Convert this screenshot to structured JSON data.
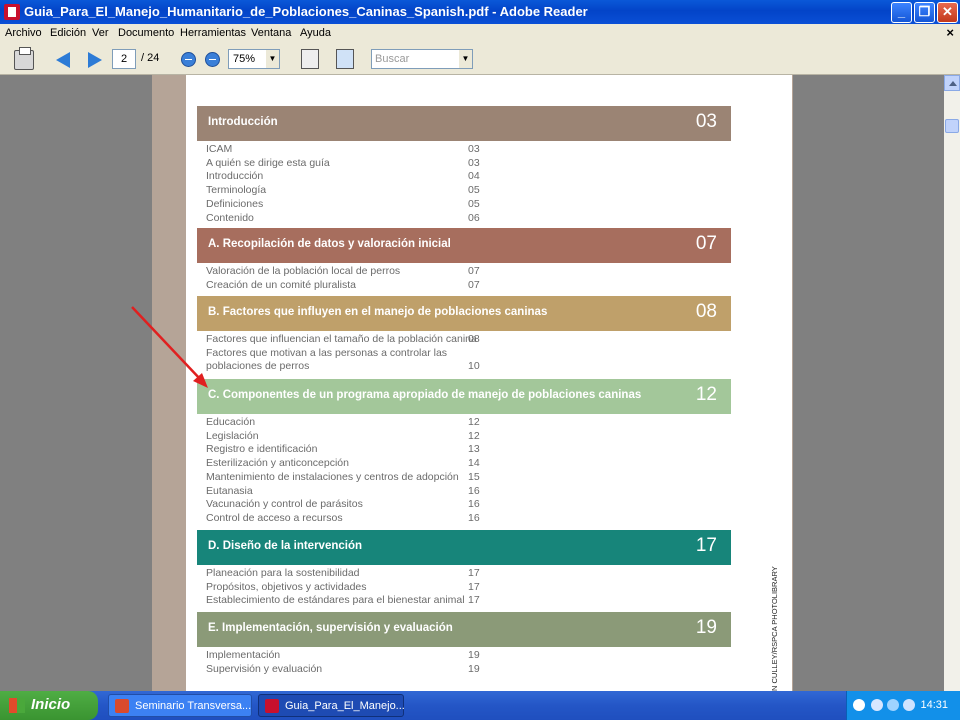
{
  "window": {
    "title": "Guia_Para_El_Manejo_Humanitario_de_Poblaciones_Caninas_Spanish.pdf - Adobe Reader",
    "minimize": "_",
    "maximize": "❐",
    "close": "✕"
  },
  "menu": {
    "items": [
      "Archivo",
      "Edición",
      "Ver",
      "Documento",
      "Herramientas",
      "Ventana",
      "Ayuda"
    ],
    "close": "×"
  },
  "toolbar": {
    "page_current": "2",
    "page_total": "/ 24",
    "zoom": "75%",
    "search_placeholder": "Buscar",
    "dropdown_glyph": "▼"
  },
  "toc": {
    "sections": [
      {
        "title": "Introducción",
        "page": "03",
        "color": "#9b8474",
        "entries": [
          {
            "text": "ICAM",
            "page": "03"
          },
          {
            "text": "A quién se dirige esta guía",
            "page": "03"
          },
          {
            "text": "Introducción",
            "page": "04"
          },
          {
            "text": "Terminología",
            "page": "05"
          },
          {
            "text": "Definiciones",
            "page": "05"
          },
          {
            "text": "Contenido",
            "page": "06"
          }
        ]
      },
      {
        "title": "A. Recopilación de datos y valoración inicial",
        "page": "07",
        "color": "#a76e5e",
        "entries": [
          {
            "text": "Valoración de la  población local de perros",
            "page": "07"
          },
          {
            "text": "Creación de un comité pluralista",
            "page": "07"
          }
        ]
      },
      {
        "title": "B. Factores que influyen en el manejo de poblaciones caninas",
        "page": "08",
        "color": "#bfa06a",
        "entries": [
          {
            "text": "Factores que influencian el tamaño de la población canina",
            "page": "08"
          },
          {
            "text": "Factores que motivan a las personas a controlar las",
            "page": ""
          },
          {
            "text": "poblaciones de perros",
            "page": "10"
          }
        ]
      },
      {
        "title": "C. Componentes de un programa apropiado de manejo de poblaciones caninas",
        "page": "12",
        "color": "#a3c79a",
        "entries": [
          {
            "text": "Educación",
            "page": "12"
          },
          {
            "text": "Legislación",
            "page": "12"
          },
          {
            "text": "Registro e identificación",
            "page": "13"
          },
          {
            "text": "Esterilización y anticoncepción",
            "page": "14"
          },
          {
            "text": "Mantenimiento de instalaciones y centros de adopción",
            "page": "15"
          },
          {
            "text": "Eutanasia",
            "page": "16"
          },
          {
            "text": "Vacunación y control de parásitos",
            "page": "16"
          },
          {
            "text": "Control de acceso a recursos",
            "page": "16"
          }
        ]
      },
      {
        "title": "D. Diseño de la intervención",
        "page": "17",
        "color": "#17857a",
        "entries": [
          {
            "text": "Planeación para la sostenibilidad",
            "page": "17"
          },
          {
            "text": "Propósitos, objetivos y actividades",
            "page": "17"
          },
          {
            "text": "Establecimiento de estándares para el bienestar animal",
            "page": "17"
          }
        ]
      },
      {
        "title": "E. Implementación, supervisión y evaluación",
        "page": "19",
        "color": "#8b9a78",
        "entries": [
          {
            "text": "Implementación",
            "page": "19"
          },
          {
            "text": "Supervisión y evaluación",
            "page": "19"
          }
        ]
      }
    ],
    "photo_credit": "N CULLEY/RSPCA PHOTOLIBRARY"
  },
  "taskbar": {
    "start_label": "Inicio",
    "tasks": [
      "Seminario Transversa...",
      "Guia_Para_El_Manejo..."
    ],
    "clock": "14:31"
  },
  "colors": {
    "annotation_arrow": "#e02020"
  }
}
